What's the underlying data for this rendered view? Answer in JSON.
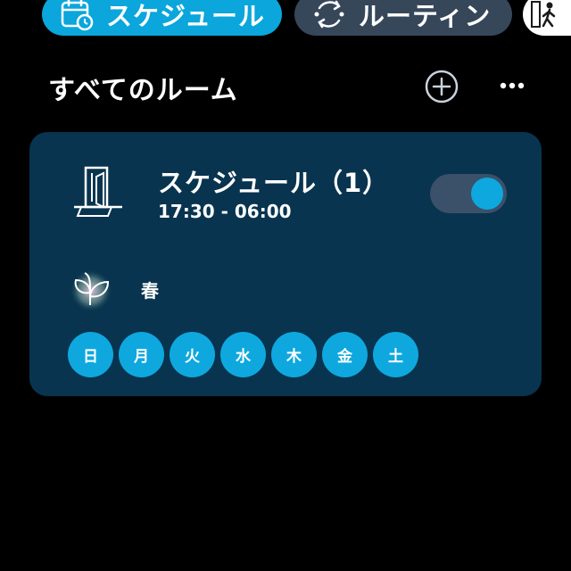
{
  "tabs": [
    {
      "label": "スケジュール",
      "icon": "calendar-clock-icon",
      "active": true
    },
    {
      "label": "ルーティン",
      "icon": "routine-cycle-icon",
      "active": false
    },
    {
      "label": "",
      "icon": "walking-person-icon",
      "active": false
    }
  ],
  "header": {
    "title": "すべてのルーム",
    "add_icon": "add-circle-icon",
    "more_icon": "more-dots-icon"
  },
  "card": {
    "device_icon": "door-sensor-icon",
    "title": "スケジュール（1）",
    "time": "17:30 - 06:00",
    "toggle_on": true,
    "season_icon": "spring-sprout-icon",
    "season": "春",
    "days": [
      "日",
      "月",
      "火",
      "水",
      "木",
      "金",
      "土"
    ]
  },
  "colors": {
    "background": "#000000",
    "accent": "#0aa6dc",
    "card": "#08344f",
    "tab_inactive": "#37475a",
    "toggle_track": "#3a5169"
  }
}
